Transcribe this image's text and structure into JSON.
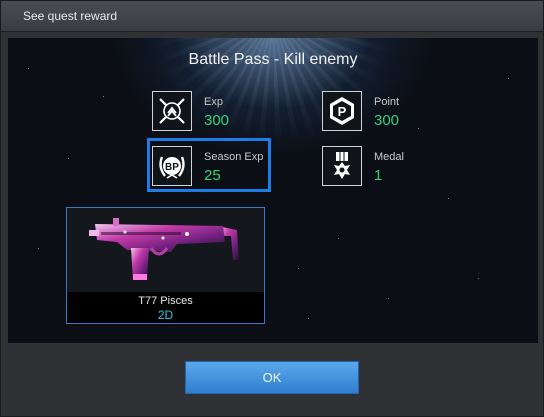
{
  "window": {
    "title": "See quest reward"
  },
  "quest": {
    "title": "Battle Pass - Kill enemy"
  },
  "rewards": [
    {
      "label": "Exp",
      "value": "300",
      "icon": "exp-icon"
    },
    {
      "label": "Point",
      "value": "300",
      "icon": "point-icon"
    },
    {
      "label": "Season Exp",
      "value": "25",
      "icon": "season-exp-icon",
      "icon_text": "BP"
    },
    {
      "label": "Medal",
      "value": "1",
      "icon": "medal-icon"
    }
  ],
  "item": {
    "name": "T77 Pisces",
    "duration": "2D",
    "icon": "submachine-gun-image"
  },
  "ok_button": {
    "label": "OK"
  },
  "colors": {
    "value_green": "#37d07a",
    "highlight_blue": "#1e7ce8",
    "duration_cyan": "#34c4e0"
  }
}
